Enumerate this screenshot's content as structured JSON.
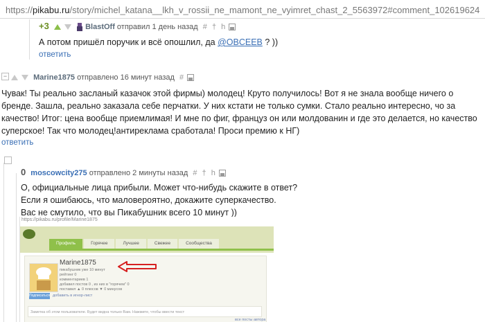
{
  "address_bar": {
    "scheme": "https://",
    "host": "pikabu.ru",
    "path": "/story/michel_katana__lkh_v_rossii_ne_mamont_ne_vyimret_chast_2_5563972#comment_102619624"
  },
  "comment_blastoff": {
    "score": "+3",
    "author": "BlastOff",
    "sent": "отправил 1 день назад",
    "tools": "# † h",
    "text_before": "А потом пришёл поручик и всё опошлил, да ",
    "mention": "@OBCEEB",
    "text_after": " ? ))",
    "reply": "ответить"
  },
  "comment_marine": {
    "score": "0",
    "author": "Marine1875",
    "sent": "отправлено 16 минут назад",
    "tools": "#",
    "text": "Чувак! Ты реально засланый казачок этой фирмы) молодец! Круто получилось! Вот я не знала вообще ничего о бренде. Зашла, реально заказала себе перчатки. У них кстати не только сумки. Стало реально интересно, чо за качество! Итог: цена вообще приемлимая! И мне по фиг, француз он или молдованин и где это делается, но качество суперское! Так что молодец!антиреклама сработала! Проси премию к НГ)",
    "reply": "ответить",
    "collapse": "−"
  },
  "comment_moscow": {
    "score": "0",
    "author": "moscowcity275",
    "sent": "отправлено 2 минуты назад",
    "tools": "# † h",
    "lines": [
      "О, официальные лица прибыли. Может что-нибудь скажите в ответ?",
      "Если я ошибаюсь, что маловероятно, докажите суперкачество.",
      "Вас не смутило, что вы Пикабушник всего 10 минут ))"
    ]
  },
  "embedded_screenshot": {
    "address": "https://pikabu.ru/profile/Marine1875",
    "tabs": [
      "Профиль",
      "Горячее",
      "Лучшее",
      "Свежее",
      "Сообщества"
    ],
    "profile_name": "Marine1875",
    "profile_lines": [
      "пикабушник уже 10 минут",
      "рейтинг 0",
      "комментариев 1",
      "добавил постов 0 , из них в \"горячем\" 0",
      "поставил ▲ 0 плюсов  ▼ 0 минусов"
    ],
    "subscribe_button": "Подписаться",
    "ignore_link": "добавить в игнор-лист",
    "note_placeholder": "Заметка об этом пользователе. Будет видна только Вам. Нажмите, чтобы ввести текст",
    "more_link": "все посты автора"
  },
  "colors": {
    "link": "#3a6fb5",
    "upvote": "#8cbf4a",
    "arrow_annotation": "#d62020"
  }
}
